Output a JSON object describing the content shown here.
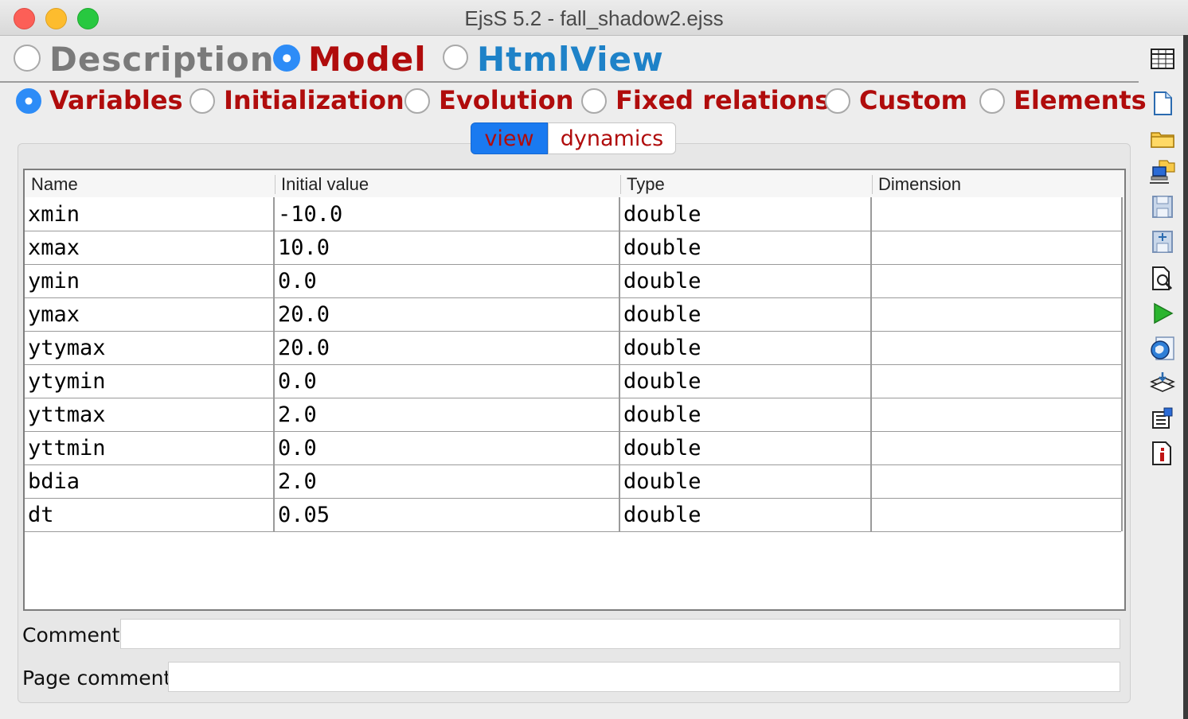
{
  "window": {
    "title": "EjsS 5.2 - fall_shadow2.ejss"
  },
  "main_tabs": [
    {
      "label": "Description",
      "selected": false,
      "color": "#7a7a7a"
    },
    {
      "label": "Model",
      "selected": true,
      "color": "#b00c0c"
    },
    {
      "label": "HtmlView",
      "selected": false,
      "color": "#1e82c8"
    }
  ],
  "model_tabs": [
    {
      "label": "Variables",
      "selected": true
    },
    {
      "label": "Initialization",
      "selected": false
    },
    {
      "label": "Evolution",
      "selected": false
    },
    {
      "label": "Fixed relations",
      "selected": false
    },
    {
      "label": "Custom",
      "selected": false
    },
    {
      "label": "Elements",
      "selected": false
    }
  ],
  "pages": [
    {
      "label": "view",
      "selected": true
    },
    {
      "label": "dynamics",
      "selected": false
    }
  ],
  "table": {
    "columns": [
      "Name",
      "Initial value",
      "Type",
      "Dimension"
    ],
    "rows": [
      [
        "xmin",
        "-10.0",
        "double",
        ""
      ],
      [
        "xmax",
        "10.0",
        "double",
        ""
      ],
      [
        "ymin",
        "0.0",
        "double",
        ""
      ],
      [
        "ymax",
        "20.0",
        "double",
        ""
      ],
      [
        "ytymax",
        "20.0",
        "double",
        ""
      ],
      [
        "ytymin",
        "0.0",
        "double",
        ""
      ],
      [
        "yttmax",
        "2.0",
        "double",
        ""
      ],
      [
        "yttmin",
        "0.0",
        "double",
        ""
      ],
      [
        "bdia",
        "2.0",
        "double",
        ""
      ],
      [
        "dt",
        "0.05",
        "double",
        ""
      ]
    ]
  },
  "comment": {
    "label": "Comment",
    "value": ""
  },
  "page_comment": {
    "label": "Page comment",
    "value": ""
  },
  "toolbar_icons": [
    "table-icon",
    "new-file-icon",
    "open-folder-icon",
    "open-network-icon",
    "save-icon",
    "save-as-icon",
    "search-icon",
    "run-icon",
    "web-browser-icon",
    "package-icon",
    "preferences-icon",
    "info-icon"
  ],
  "colors": {
    "accent": "#2d8cf7",
    "red_label": "#b00c0c",
    "blue_label": "#1e82c8"
  }
}
